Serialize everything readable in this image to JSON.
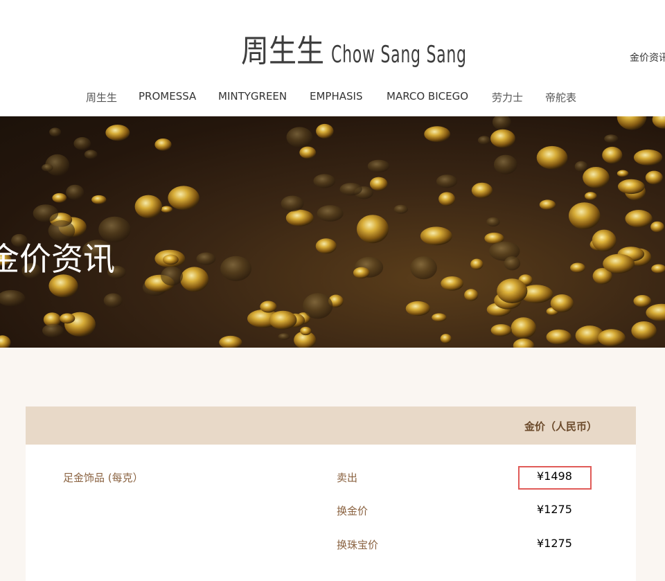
{
  "brand": {
    "name_cn": "周生生",
    "name_en": "Chow Sang Sang"
  },
  "header": {
    "top_link": "金价资讯"
  },
  "nav": {
    "items": [
      {
        "label": "周生生"
      },
      {
        "label": "PROMESSA"
      },
      {
        "label": "MINTYGREEN"
      },
      {
        "label": "EMPHASIS"
      },
      {
        "label": "MARCO BICEGO"
      },
      {
        "label": "劳力士"
      },
      {
        "label": "帝舵表"
      }
    ]
  },
  "banner": {
    "title": "金价资讯"
  },
  "gold_table": {
    "header": "金价（人民币）",
    "product": "足金饰品 (每克）",
    "rows": [
      {
        "type": "卖出",
        "price": "¥1498"
      },
      {
        "type": "换金价",
        "price": "¥1275"
      },
      {
        "type": "换珠宝价",
        "price": "¥1275"
      }
    ],
    "highlight_color": "#e05a57"
  },
  "colors": {
    "background": "#faf6f2",
    "table_header": "#e8d9c8",
    "label_brown": "#8a6240"
  }
}
